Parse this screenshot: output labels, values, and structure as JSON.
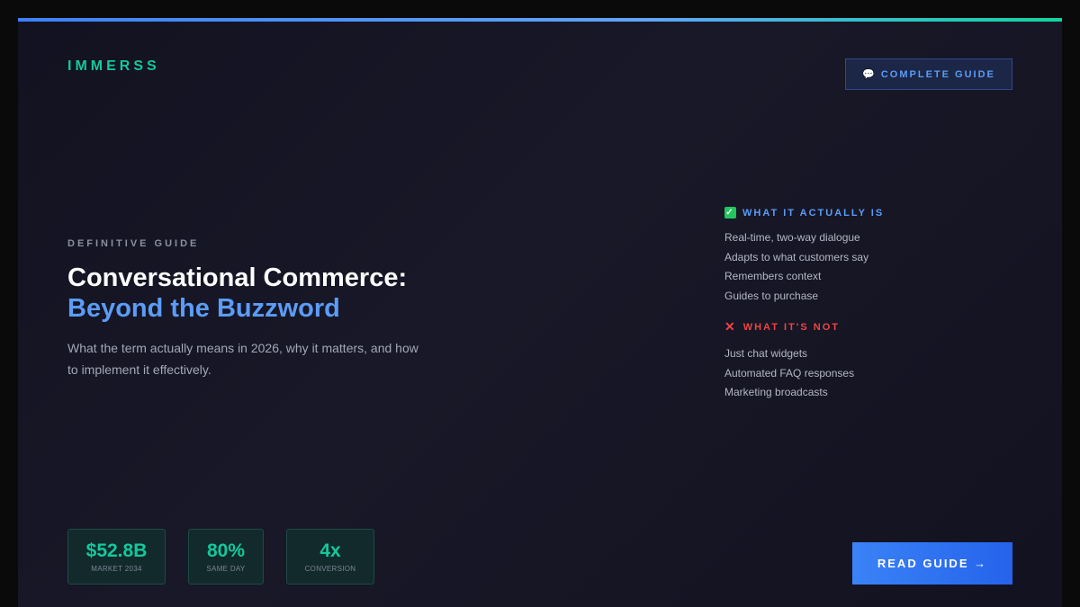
{
  "brand": {
    "name": "IMMERSS"
  },
  "top_button": {
    "icon": "speech-bubble-icon",
    "label": "COMPLETE GUIDE"
  },
  "hero": {
    "kicker": "DEFINITIVE GUIDE",
    "title_line1": "Conversational Commerce:",
    "title_line2": "Beyond the Buzzword",
    "subtitle": "What the term actually means in 2026, why it matters, and how to implement it effectively."
  },
  "is_section": {
    "icon": "check-icon",
    "heading": "WHAT IT ACTUALLY IS",
    "items": [
      "Real-time, two-way dialogue",
      "Adapts to what customers say",
      "Remembers context",
      "Guides to purchase"
    ]
  },
  "not_section": {
    "icon": "cross-icon",
    "heading": "WHAT IT'S NOT",
    "items": [
      "Just chat widgets",
      "Automated FAQ responses",
      "Marketing broadcasts"
    ]
  },
  "stats": [
    {
      "value": "$52.8B",
      "label": "MARKET 2034"
    },
    {
      "value": "80%",
      "label": "SAME DAY"
    },
    {
      "value": "4x",
      "label": "CONVERSION"
    }
  ],
  "cta": {
    "label": "READ GUIDE →"
  },
  "colors": {
    "accent_blue": "#5b9cf6",
    "accent_green": "#12c99b",
    "danger": "#ef4444",
    "background": "#161625"
  }
}
